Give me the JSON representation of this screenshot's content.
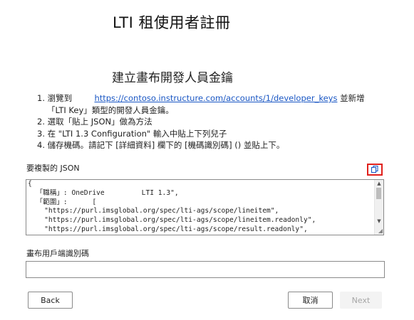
{
  "header": {
    "title": "LTI 租使用者註冊",
    "subtitle": "建立畫布開發人員金鑰"
  },
  "steps": [
    {
      "number": "1.",
      "text_before": "瀏覽到",
      "link": "https://contoso.instructure.com/accounts/1/developer_keys",
      "text_after": "並新增",
      "continuation": "「LTI Key」類型的開發人員金鑰。"
    },
    {
      "number": "2.",
      "text": "選取「貼上 JSON」做為方法"
    },
    {
      "number": "3.",
      "text": "在 \"LTI 1.3 Configuration\" 輸入中貼上下列兒子"
    },
    {
      "number": "4.",
      "text": "儲存機碼。請記下 [詳細資料] 欄下的 [機碼識別碼] () 並貼上下。"
    }
  ],
  "json_section": {
    "label": "要複製的 JSON",
    "copy_icon": "copy-icon",
    "code": "{\n  「職稱」: OneDrive         LTI 1.3\",\n  「範圍」:      [\n    \"https://purl.imsglobal.org/spec/lti-ags/scope/lineitem\",\n    \"https://purl.imsglobal.org/spec/lti-ags/scope/lineitem.readonly\",\n    \"https://purl.imsglobal.org/spec/lti-ags/scope/result.readonly\",\n    \"https://purl.imsglobal.org/spec/lti-ags/scope/score\""
  },
  "client_id": {
    "label": "畫布用戶端識別碼",
    "value": "",
    "placeholder": ""
  },
  "buttons": {
    "back": "Back",
    "cancel": "取消",
    "next": "Next"
  },
  "colors": {
    "link": "#1a57c4",
    "copy_highlight": "#e0201c",
    "disabled_bg": "#f3f3f3",
    "disabled_text": "#a6a6a6"
  }
}
